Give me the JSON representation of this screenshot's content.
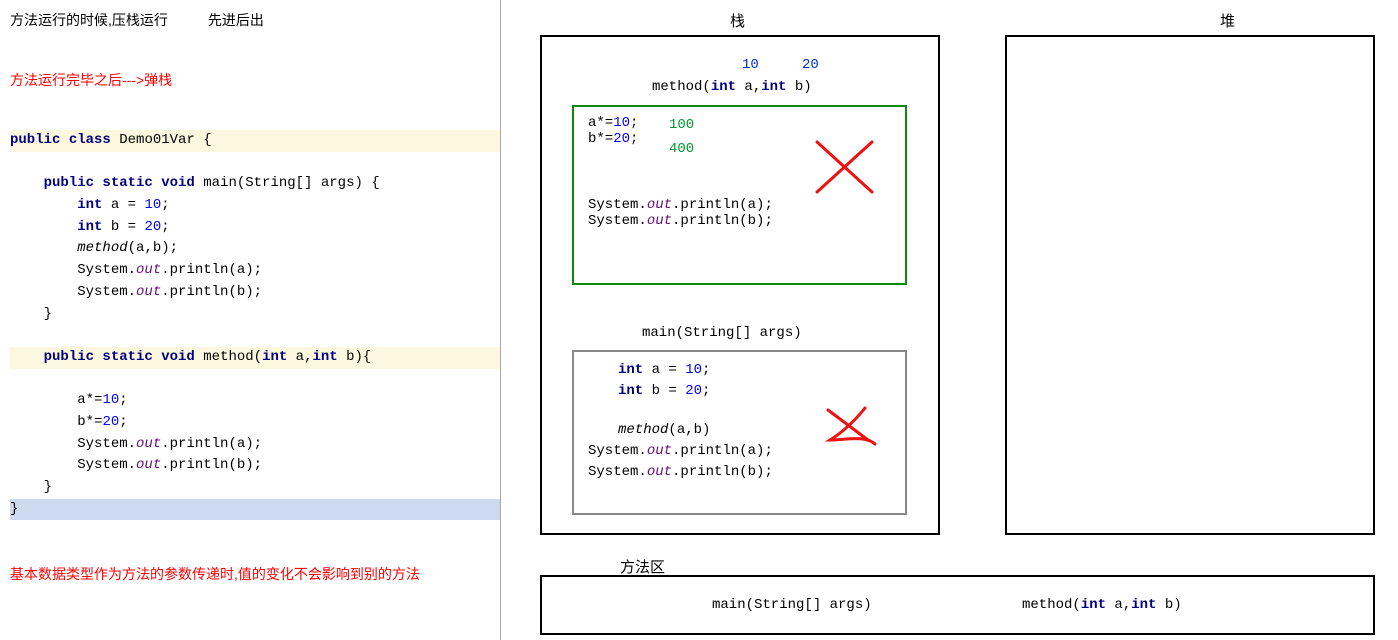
{
  "left": {
    "note1": "方法运行的时候,压栈运行",
    "note2": "先进后出",
    "note3": "方法运行完毕之后--->弹栈",
    "code": {
      "l1a": "public",
      "l1b": " class",
      "l1c": " Demo01Var ",
      "l2a": "public static void",
      "l2b": " main(String[] args) {",
      "l3a": "int",
      "l3b": " a = ",
      "l3c": "10",
      "l3d": ";",
      "l4a": "int",
      "l4b": " b = ",
      "l4c": "20",
      "l4d": ";",
      "l5a": "method",
      "l5b": "(a,b);",
      "l6a": "System.",
      "l6b": "out",
      "l6c": ".println(a);",
      "l7a": "System.",
      "l7b": "out",
      "l7c": ".println(b);",
      "l8": "}",
      "l10a": "public static void",
      "l10b": " method(",
      "l10c": "int",
      "l10d": " a,",
      "l10e": "int",
      "l10f": " b){",
      "l11a": "a*=",
      "l11b": "10",
      "l11c": ";",
      "l12a": "b*=",
      "l12b": "20",
      "l12c": ";",
      "l13a": "System.",
      "l13b": "out",
      "l13c": ".println(a);",
      "l14a": "System.",
      "l14b": "out",
      "l14c": ".println(b);",
      "l15": "}",
      "l16": "}"
    },
    "note4": "基本数据类型作为方法的参数传递时,值的变化不会影响到别的方法"
  },
  "right": {
    "stackLabel": "栈",
    "heapLabel": "堆",
    "methodAreaLabel": "方法区",
    "method": {
      "arg1": "10",
      "arg2": "20",
      "sigA": "method(",
      "sigB": "int",
      "sigC": " a,",
      "sigD": "int",
      "sigE": " b)",
      "b1a": "a*=",
      "b1b": "10",
      "b1c": ";",
      "b2a": "b*=",
      "b2b": "20",
      "b2c": ";",
      "val1": "100",
      "val2": "400",
      "p1a": "System.",
      "p1b": "out",
      "p1c": ".println(a);",
      "p2a": "System.",
      "p2b": "out",
      "p2c": ".println(b);"
    },
    "main": {
      "sig": "main(String[] args)",
      "l1a": "int",
      "l1b": " a = ",
      "l1c": "10",
      "l1d": ";",
      "l2a": "int",
      "l2b": " b = ",
      "l2c": "20",
      "l2d": ";",
      "l3a": "method",
      "l3b": "(a,b)",
      "l4a": "System.",
      "l4b": "out",
      "l4c": ".println(a);",
      "l5a": "System.",
      "l5b": "out",
      "l5c": ".println(b);"
    },
    "marea": {
      "sig1": "main(String[] args)",
      "sig2a": "method(",
      "sig2b": "int",
      "sig2c": " a,",
      "sig2d": "int",
      "sig2e": " b)"
    }
  }
}
